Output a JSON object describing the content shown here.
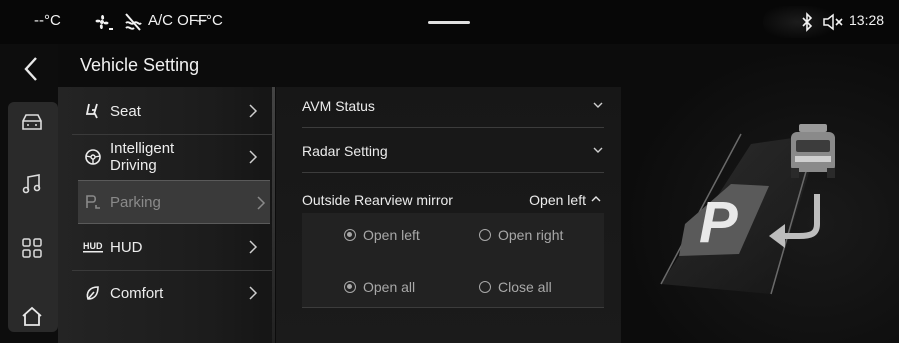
{
  "status_bar": {
    "temp_left": "--°C",
    "ac_label": "A/C OFF",
    "temp_right": "--°C",
    "clock": "13:28",
    "icons": [
      "fan-icon",
      "ac-icon",
      "bluetooth-icon",
      "mute-icon"
    ]
  },
  "page": {
    "title": "Vehicle Setting"
  },
  "rail": {
    "icons": [
      "back-icon",
      "car-icon",
      "music-icon",
      "apps-icon",
      "home-icon"
    ]
  },
  "menu": {
    "items": [
      {
        "label": "Seat",
        "icon": "seat-icon"
      },
      {
        "label": "Intelligent Driving",
        "label_line1": "Intelligent",
        "label_line2": "Driving",
        "icon": "steering-wheel-icon"
      },
      {
        "label": "Parking",
        "icon": "parking-icon",
        "selected": true
      },
      {
        "label": "HUD",
        "icon": "hud-icon"
      },
      {
        "label": "Comfort",
        "icon": "comfort-icon"
      }
    ]
  },
  "detail": {
    "avm_status": "AVM Status",
    "radar_setting": "Radar Setting",
    "mirror_label": "Outside Rearview mirror",
    "mirror_value": "Open left",
    "options": {
      "open_left": "Open left",
      "open_right": "Open right",
      "open_all": "Open all",
      "close_all": "Close all",
      "selected": [
        "Open left",
        "Open all"
      ]
    }
  },
  "illustration": {
    "letter": "P"
  },
  "colors": {
    "background": "#0c0c0c",
    "panel": "#1c1c1c",
    "selected": "#3a3a3a",
    "text": "#e6e6e6",
    "muted": "#8a8a8a"
  }
}
